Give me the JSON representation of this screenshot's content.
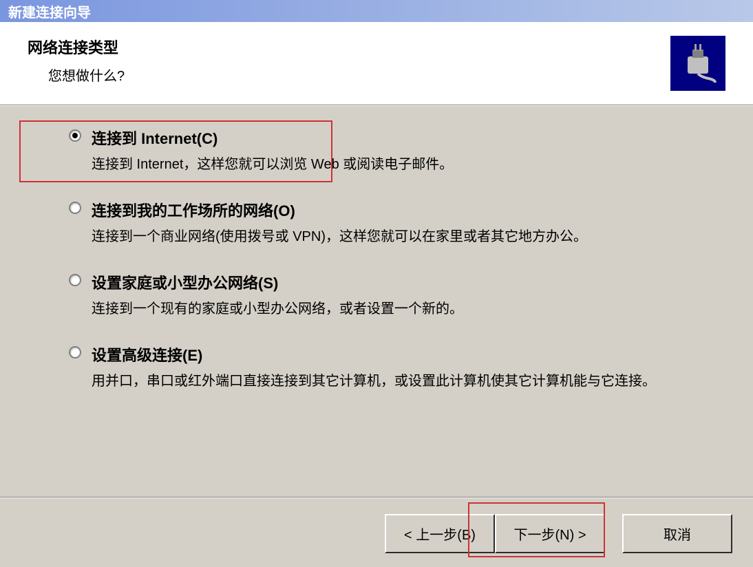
{
  "titlebar": "新建连接向导",
  "header": {
    "title": "网络连接类型",
    "subtitle": "您想做什么?"
  },
  "options": [
    {
      "label": "连接到 Internet(C)",
      "desc": "连接到 Internet，这样您就可以浏览 Web 或阅读电子邮件。",
      "selected": true
    },
    {
      "label": "连接到我的工作场所的网络(O)",
      "desc": "连接到一个商业网络(使用拨号或 VPN)，这样您就可以在家里或者其它地方办公。",
      "selected": false
    },
    {
      "label": "设置家庭或小型办公网络(S)",
      "desc": "连接到一个现有的家庭或小型办公网络，或者设置一个新的。",
      "selected": false
    },
    {
      "label": "设置高级连接(E)",
      "desc": "用并口，串口或红外端口直接连接到其它计算机，或设置此计算机使其它计算机能与它连接。",
      "selected": false
    }
  ],
  "buttons": {
    "back": "< 上一步(B)",
    "next": "下一步(N) >",
    "cancel": "取消"
  }
}
